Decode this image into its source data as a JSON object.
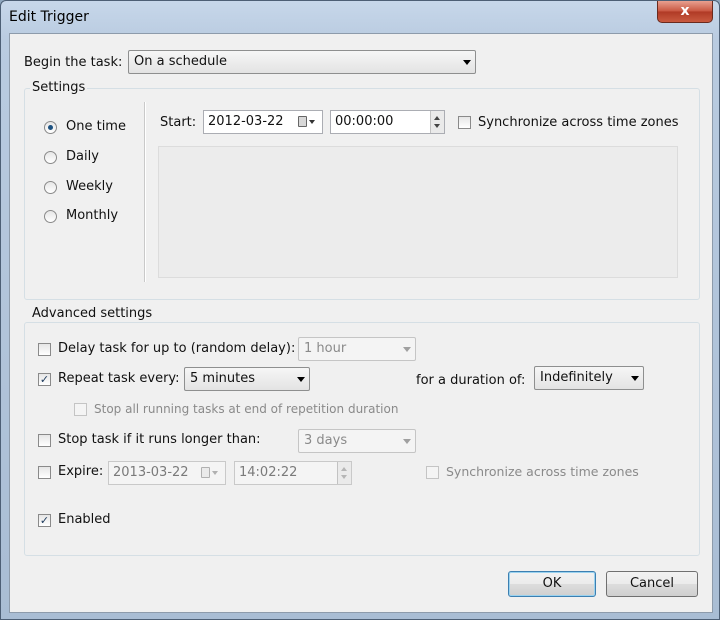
{
  "window": {
    "title": "Edit Trigger",
    "close_label": "x"
  },
  "begin": {
    "label": "Begin the task:",
    "value": "On a schedule"
  },
  "settings": {
    "group_title": "Settings",
    "radios": [
      {
        "label": "One time",
        "checked": true
      },
      {
        "label": "Daily",
        "checked": false
      },
      {
        "label": "Weekly",
        "checked": false
      },
      {
        "label": "Monthly",
        "checked": false
      }
    ],
    "start_label": "Start:",
    "start_date": "2012-03-22",
    "start_time": "00:00:00",
    "sync_label": "Synchronize across time zones",
    "sync_checked": false
  },
  "advanced": {
    "group_title": "Advanced settings",
    "delay": {
      "label": "Delay task for up to (random delay):",
      "checked": false,
      "value": "1 hour"
    },
    "repeat": {
      "label": "Repeat task every:",
      "checked": true,
      "value": "5 minutes",
      "duration_label": "for a duration of:",
      "duration_value": "Indefinitely"
    },
    "stop_all": {
      "label": "Stop all running tasks at end of repetition duration",
      "checked": false
    },
    "stop_longer": {
      "label": "Stop task if it runs longer than:",
      "checked": false,
      "value": "3 days"
    },
    "expire": {
      "label": "Expire:",
      "checked": false,
      "date": "2013-03-22",
      "time": "14:02:22",
      "sync_label": "Synchronize across time zones",
      "sync_checked": false
    },
    "enabled": {
      "label": "Enabled",
      "checked": true
    }
  },
  "buttons": {
    "ok": "OK",
    "cancel": "Cancel"
  },
  "colors": {
    "title_bar": "#b9cbe0",
    "close_button": "#c8553f",
    "dialog_bg": "#f0f0f0",
    "default_button_border": "#3c7fb1"
  }
}
